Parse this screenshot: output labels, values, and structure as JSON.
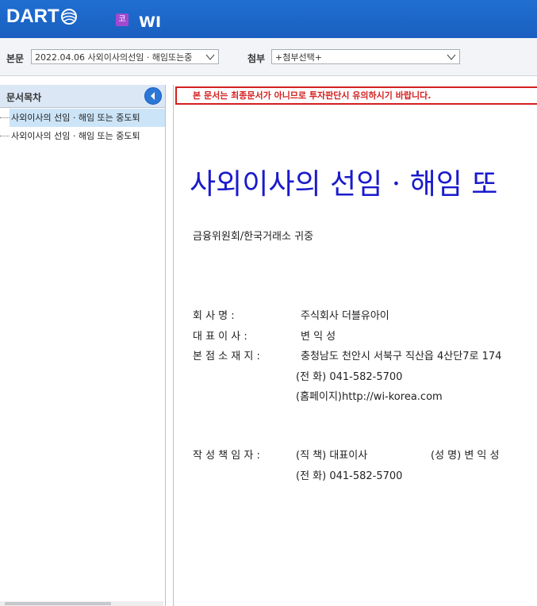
{
  "header": {
    "logo_text": "DART",
    "corp_badge": "코",
    "corp_name": "WI"
  },
  "toolbar": {
    "body_label": "본문",
    "body_select": "2022.04.06  사외이사의선임 · 해임또는중",
    "attach_label": "첨부",
    "attach_select": "+첨부선택+"
  },
  "sidebar": {
    "title": "문서목차",
    "items": [
      {
        "label": "사외이사의 선임 · 해임 또는 중도퇴"
      },
      {
        "label": "사외이사의 선임 · 해임 또는 중도퇴"
      }
    ]
  },
  "document": {
    "notice": "본 문서는 최종문서가 아니므로 투자판단시 유의하시기 바랍니다.",
    "title": "사외이사의 선임 · 해임 또",
    "recipient": "금융위원회/한국거래소 귀중",
    "company_label": "회   사   명 :",
    "company_value": "주식회사 더블유아이",
    "ceo_label": "대 표 이 사 :",
    "ceo_value": "변 익 성",
    "address_label": "본 점 소 재 지 :",
    "address_value": "충청남도 천안시 서북구 직산읍 4산단7로 174",
    "phone_line": "(전    화) 041-582-5700",
    "homepage_line": "(홈페이지)http://wi-korea.com",
    "author_label": "작 성 책 임 자 :",
    "author_position": "(직  책) 대표이사",
    "author_name": "(성  명) 변 익 성",
    "author_phone": "(전  화) 041-582-5700"
  }
}
